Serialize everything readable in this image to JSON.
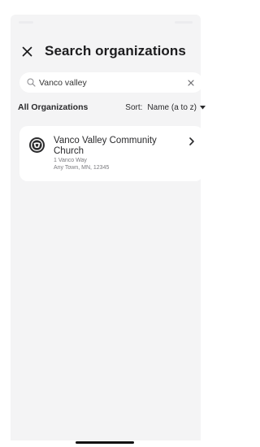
{
  "header": {
    "close_icon": "close-icon",
    "title": "Search organizations"
  },
  "search": {
    "icon": "search-icon",
    "value": "Vanco valley",
    "clear_icon": "close-icon"
  },
  "filter": {
    "label": "All Organizations",
    "sort_label": "Sort:",
    "sort_value": "Name (a to z)",
    "sort_icon": "caret-down-icon"
  },
  "results": [
    {
      "name": "Vanco Valley Community Church",
      "address_line1": "1 Vanco Way",
      "address_line2": "Any Town, MN, 12345",
      "logo_icon": "organization-logo-icon",
      "action_icon": "chevron-right-icon"
    }
  ],
  "colors": {
    "panel_background": "#f4f4f5",
    "card_background": "#ffffff",
    "title_text": "#1c1c1e",
    "secondary_text": "#7a7a7e"
  }
}
